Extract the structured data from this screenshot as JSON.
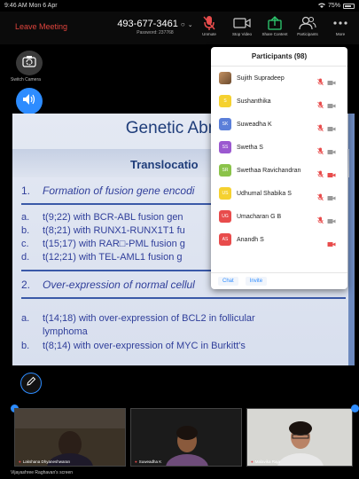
{
  "status_bar": {
    "time": "9:46 AM",
    "date": "Mon 6 Apr",
    "battery": "75%",
    "battery_level": 0.75
  },
  "top_bar": {
    "leave_label": "Leave Meeting",
    "meeting_id": "493-677-3461",
    "password": "Password: 237768",
    "tools": [
      {
        "label": "Unmute",
        "icon": "mic-muted-icon"
      },
      {
        "label": "Stop Video",
        "icon": "video-icon"
      },
      {
        "label": "Share Content",
        "icon": "share-icon"
      },
      {
        "label": "Participants",
        "icon": "participants-icon"
      },
      {
        "label": "More",
        "icon": "more-icon"
      }
    ]
  },
  "left_controls": {
    "switch_camera": "Switch Camera"
  },
  "slide": {
    "title": "Genetic Abnor",
    "subtitle": "Translocatio",
    "lines": [
      {
        "n": "1.",
        "text": "Formation of fusion gene encodi",
        "style": "item"
      },
      {
        "n": "a.",
        "text": "t(9;22) with BCR-ABL fusion gen"
      },
      {
        "n": "b.",
        "text": "t(8;21) with RUNX1-RUNX1T1 fu"
      },
      {
        "n": "c.",
        "text": "t(15;17) with RAR□-PML fusion g"
      },
      {
        "n": "d.",
        "text": "t(12;21) with TEL-AML1 fusion g"
      },
      {
        "n": "2.",
        "text": "Over-expression of normal cellul",
        "style": "item"
      },
      {
        "n": "a.",
        "text": "t(14;18) with over-expression of BCL2 in follicular"
      },
      {
        "n": "",
        "text": "lymphoma"
      },
      {
        "n": "b.",
        "text": "t(8;14) with over-expression of MYC in Burkitt's"
      }
    ]
  },
  "participants": {
    "title": "Participants (98)",
    "items": [
      {
        "name": "Sujith Supradeep",
        "initials": "",
        "color": "#9a6b3c",
        "mic": "muted",
        "video": "off"
      },
      {
        "name": "Sushanthika",
        "initials": "S",
        "color": "#f5d130",
        "mic": "muted",
        "video": "off"
      },
      {
        "name": "Suweadha K",
        "initials": "SK",
        "color": "#5b7fd9",
        "mic": "muted",
        "video": "off"
      },
      {
        "name": "Swetha S",
        "initials": "SS",
        "color": "#9b59d0",
        "mic": "muted",
        "video": "off"
      },
      {
        "name": "Swethaa Ravichandran",
        "initials": "SR",
        "color": "#8bc34a",
        "mic": "muted",
        "video": "stopped"
      },
      {
        "name": "Udhumal Shabika S",
        "initials": "US",
        "color": "#f5d130",
        "mic": "muted",
        "video": "off"
      },
      {
        "name": "Umacharan G B",
        "initials": "UG",
        "color": "#e84c4c",
        "mic": "muted",
        "video": "off"
      },
      {
        "name": "Anandh S",
        "initials": "AS",
        "color": "#e84c4c",
        "mic": "none",
        "video": "stopped"
      }
    ],
    "chat_label": "Chat",
    "invite_label": "Invite"
  },
  "videos": [
    {
      "name": "Lakshana Dhyaneshwaran"
    },
    {
      "name": "Suweadha K"
    },
    {
      "name": "Malavika Raja"
    }
  ],
  "screen_owner": "Vijayashree Raghavan's screen"
}
